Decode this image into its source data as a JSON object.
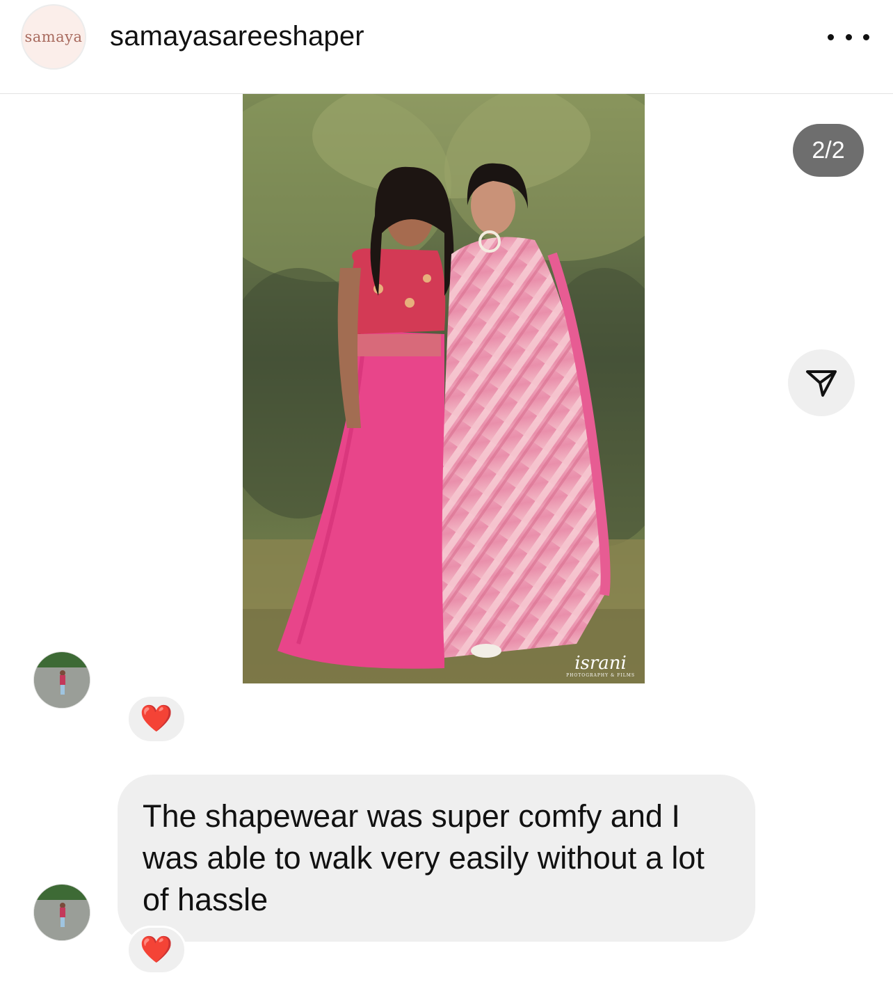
{
  "header": {
    "brand_logo_text": "samaya",
    "username": "samayasareeshaper"
  },
  "post": {
    "counter": "2/2",
    "watermark_main": "israni",
    "watermark_sub": "PHOTOGRAPHY & FILMS"
  },
  "messages": [
    {
      "type": "image",
      "reaction": "❤️"
    },
    {
      "type": "text",
      "text": "The shapewear was super comfy and I was able to walk very easily without a lot of hassle",
      "reaction": "❤️"
    }
  ],
  "icons": {
    "more": "more-horizontal-icon",
    "share": "send-icon",
    "reaction": "heart-icon"
  },
  "colors": {
    "reaction_heart": "#e0152b",
    "counter_bg": "#6e6e6e",
    "bubble_bg": "#efefef"
  }
}
